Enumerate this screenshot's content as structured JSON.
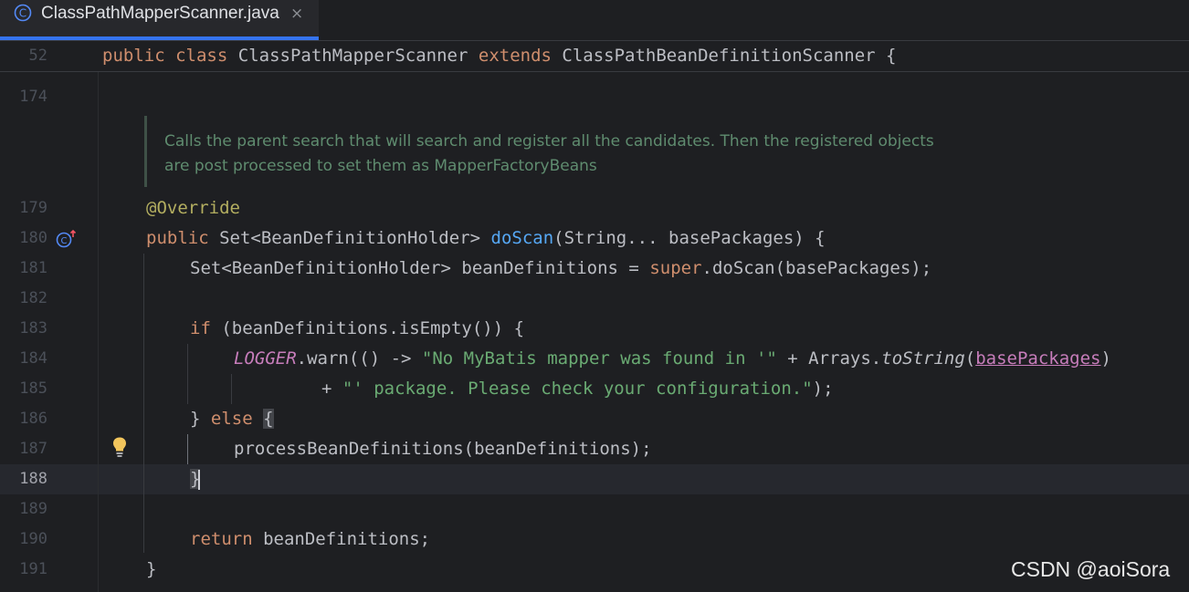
{
  "tab": {
    "title": "ClassPathMapperScanner.java",
    "close": "×",
    "icon": "class-icon",
    "accent": "#3574f0"
  },
  "sticky_line": {
    "number": "52",
    "kw1": "public",
    "kw2": "class",
    "name": "ClassPathMapperScanner",
    "kw3": "extends",
    "parent": "ClassPathBeanDefinitionScanner",
    "brace": "{"
  },
  "doc_comment": {
    "line1": "Calls the parent search that will search and register all the candidates. Then the registered objects",
    "line2": "are post processed to set them as MapperFactoryBeans"
  },
  "line_numbers": {
    "l174": "174",
    "l179": "179",
    "l180": "180",
    "l181": "181",
    "l182": "182",
    "l183": "183",
    "l184": "184",
    "l185": "185",
    "l186": "186",
    "l187": "187",
    "l188": "188",
    "l189": "189",
    "l190": "190",
    "l191": "191"
  },
  "code": {
    "l179_annotation": "@Override",
    "l180_kw": "public",
    "l180_type": "Set<BeanDefinitionHolder>",
    "l180_fn": "doScan",
    "l180_args": "(String... basePackages) {",
    "l181_a": "Set<BeanDefinitionHolder> beanDefinitions = ",
    "l181_kw": "super",
    "l181_b": ".doScan(basePackages);",
    "l183_kw": "if",
    "l183_rest": " (beanDefinitions.isEmpty()) {",
    "l184_logger": "LOGGER",
    "l184_a": ".warn(() -> ",
    "l184_str": "\"No MyBatis mapper was found in '\"",
    "l184_b": " + Arrays.",
    "l184_method": "toString",
    "l184_paren": "(",
    "l184_param": "basePackages",
    "l184_close": ")",
    "l185_a": "+ ",
    "l185_str": "\"' package. Please check your configuration.\"",
    "l185_b": ");",
    "l186_a": "} ",
    "l186_kw": "else",
    "l186_brace": "{",
    "l187": "processBeanDefinitions(beanDefinitions);",
    "l188": "}",
    "l190_kw": "return",
    "l190_rest": " beanDefinitions;",
    "l191": "}"
  },
  "gutter_icons": {
    "override": "override-method-icon",
    "bulb": "lightbulb-intention-icon"
  },
  "watermark": "CSDN @aoiSora",
  "colors": {
    "background": "#1e1f22",
    "keyword": "#cf8e6d",
    "function": "#56a8f5",
    "string": "#6aab73",
    "annotation": "#b3ae60",
    "static_field": "#c77dbb",
    "doc_comment": "#5f8c6f",
    "bulb": "#f2c55c"
  }
}
